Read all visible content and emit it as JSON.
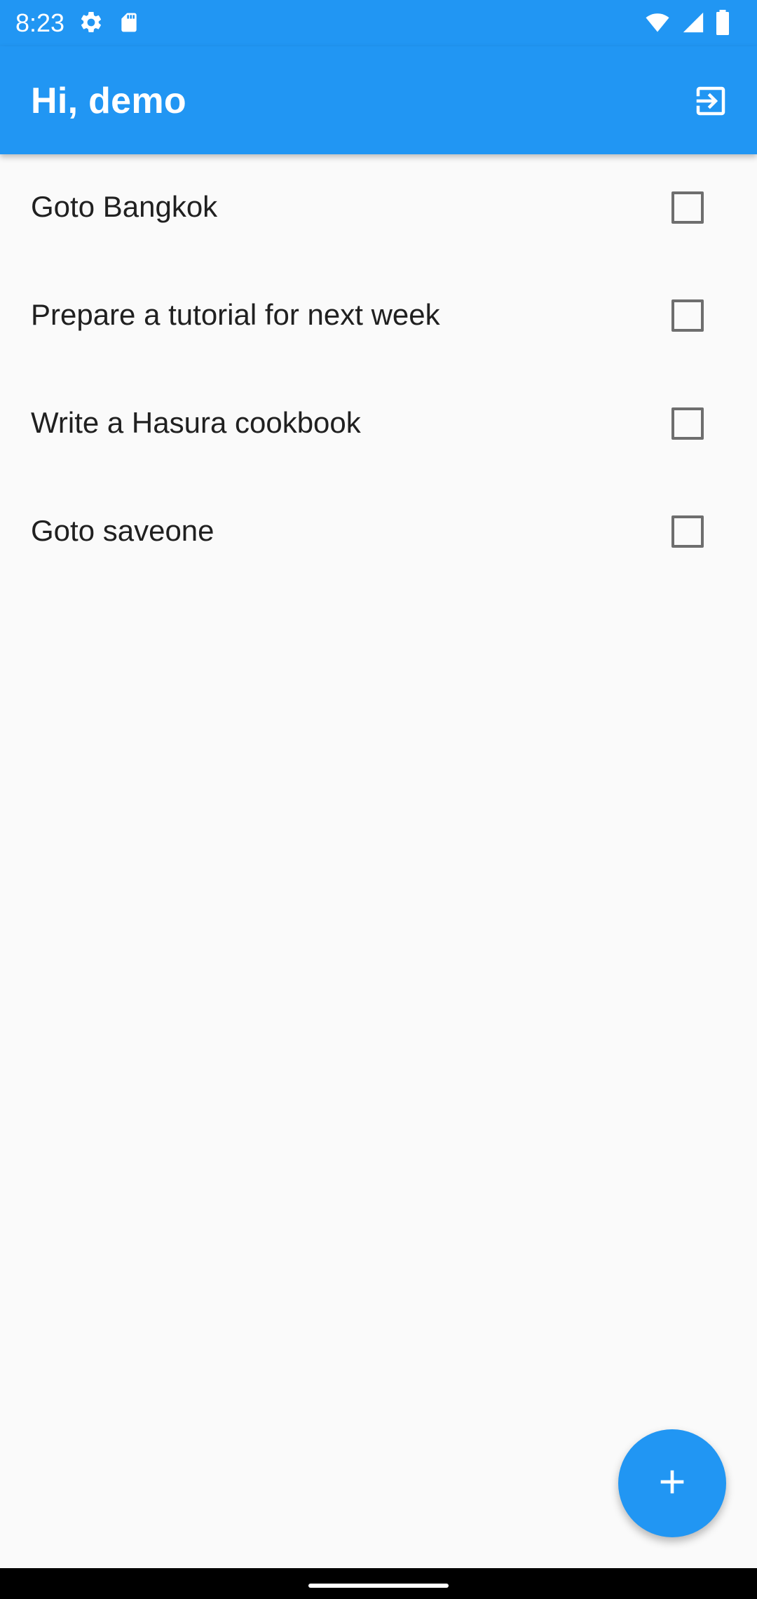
{
  "status_bar": {
    "time": "8:23",
    "left_icons": [
      "gear-icon",
      "sd-card-icon"
    ],
    "right_icons": [
      "wifi-icon",
      "signal-icon",
      "battery-icon"
    ]
  },
  "app_bar": {
    "title": "Hi, demo",
    "action_icon": "logout-icon"
  },
  "todos": [
    {
      "title": "Goto Bangkok",
      "completed": false
    },
    {
      "title": "Prepare a tutorial for next week",
      "completed": false
    },
    {
      "title": "Write a Hasura cookbook",
      "completed": false
    },
    {
      "title": "Goto saveone",
      "completed": false
    }
  ],
  "fab": {
    "icon": "plus-icon"
  },
  "colors": {
    "primary": "#2196f3",
    "background": "#fafafa",
    "checkbox_border": "#6e6e6e",
    "text": "#202020"
  }
}
